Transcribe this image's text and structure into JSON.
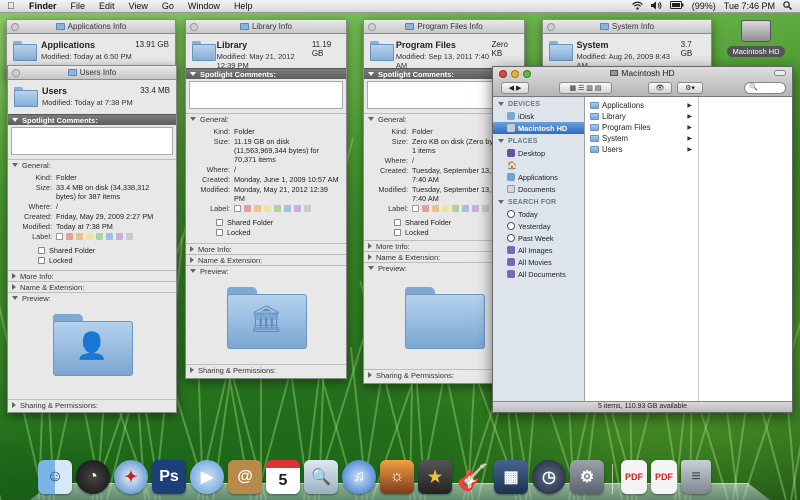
{
  "menubar": {
    "apple": "",
    "items": [
      "Finder",
      "File",
      "Edit",
      "View",
      "Go",
      "Window",
      "Help"
    ],
    "battery": "(99%)",
    "clock": "Tue 7:46 PM"
  },
  "desktop_disk": {
    "label": "Macintosh HD"
  },
  "win_applications": {
    "title": "Applications Info",
    "name": "Applications",
    "size": "13.91 GB",
    "modified": "Modified: Today at 6:50 PM"
  },
  "win_users": {
    "title": "Users Info",
    "name": "Users",
    "size": "33.4 MB",
    "modified": "Modified: Today at 7:38 PM",
    "spotlight": "Spotlight Comments:",
    "general": "General:",
    "kind_k": "Kind:",
    "kind_v": "Folder",
    "size_k": "Size:",
    "size_v": "33.4 MB on disk (34,338,312 bytes) for 387 items",
    "where_k": "Where:",
    "where_v": "/",
    "created_k": "Created:",
    "created_v": "Friday, May 29, 2009 2:27 PM",
    "modified_k": "Modified:",
    "modified_v": "Today at 7:38 PM",
    "label_k": "Label:",
    "shared": "Shared Folder",
    "locked": "Locked",
    "more_info": "More Info:",
    "name_ext": "Name & Extension:",
    "preview": "Preview:",
    "sharing": "Sharing & Permissions:"
  },
  "win_library": {
    "title": "Library Info",
    "name": "Library",
    "size": "11.19 GB",
    "modified": "Modified: May 21, 2012 12:39 PM",
    "spotlight": "Spotlight Comments:",
    "general": "General:",
    "kind_k": "Kind:",
    "kind_v": "Folder",
    "size_k": "Size:",
    "size_v": "11.19 GB on disk (11,563,969,344 bytes) for 70,371 items",
    "where_k": "Where:",
    "where_v": "/",
    "created_k": "Created:",
    "created_v": "Monday, June 1, 2009 10:57 AM",
    "modified_k": "Modified:",
    "modified_v": "Monday, May 21, 2012 12:39 PM",
    "label_k": "Label:",
    "shared": "Shared Folder",
    "locked": "Locked",
    "more_info": "More Info:",
    "name_ext": "Name & Extension:",
    "preview": "Preview:",
    "sharing": "Sharing & Permissions:"
  },
  "win_programfiles": {
    "title": "Program Files Info",
    "name": "Program Files",
    "size": "Zero KB",
    "modified": "Modified: Sep 13, 2011 7:40 AM",
    "spotlight": "Spotlight Comments:",
    "general": "General:",
    "kind_k": "Kind:",
    "kind_v": "Folder",
    "size_k": "Size:",
    "size_v": "Zero KB on disk (Zero bytes) for 1 items",
    "where_k": "Where:",
    "where_v": "/",
    "created_k": "Created:",
    "created_v": "Tuesday, September 13, 2011 7:40 AM",
    "modified_k": "Modified:",
    "modified_v": "Tuesday, September 13, 2011 7:40 AM",
    "label_k": "Label:",
    "shared": "Shared Folder",
    "locked": "Locked",
    "more_info": "More Info:",
    "name_ext": "Name & Extension:",
    "preview": "Preview:",
    "sharing": "Sharing & Permissions:"
  },
  "win_system": {
    "title": "System Info",
    "name": "System",
    "size": "3.7 GB",
    "modified": "Modified: Aug 26, 2009 8:43 AM"
  },
  "finder": {
    "title": "Macintosh HD",
    "search_placeholder": "",
    "devices_header": "DEVICES",
    "devices": [
      "iDisk",
      "Macintosh HD"
    ],
    "places_header": "PLACES",
    "places": [
      "Desktop",
      "",
      "Applications",
      "Documents"
    ],
    "search_header": "SEARCH FOR",
    "searches": [
      "Today",
      "Yesterday",
      "Past Week",
      "All Images",
      "All Movies",
      "All Documents"
    ],
    "items": [
      "Applications",
      "Library",
      "Program Files",
      "System",
      "Users"
    ],
    "status": "5 items, 110.93 GB available"
  },
  "colors": {
    "selection": "#2f6cc2",
    "folder": "#85aed6",
    "labels": [
      "#e06060",
      "#f0a040",
      "#f0e060",
      "#80c060",
      "#60a0e0",
      "#b080d0",
      "#b0b0b0"
    ]
  },
  "dock": {
    "icons": [
      "finder-icon",
      "dashboard-icon",
      "safari-icon",
      "photoshop-icon",
      "ichat-icon",
      "address-book-icon",
      "ical-icon",
      "preview-icon",
      "itunes-icon",
      "iphoto-icon",
      "imovie-icon",
      "garageband-icon",
      "spaces-icon",
      "time-machine-icon",
      "system-preferences-icon",
      "pdf-document-icon",
      "pdf-document-icon",
      "trash-icon"
    ],
    "ps_text": "Ps",
    "cal_day": "5"
  }
}
